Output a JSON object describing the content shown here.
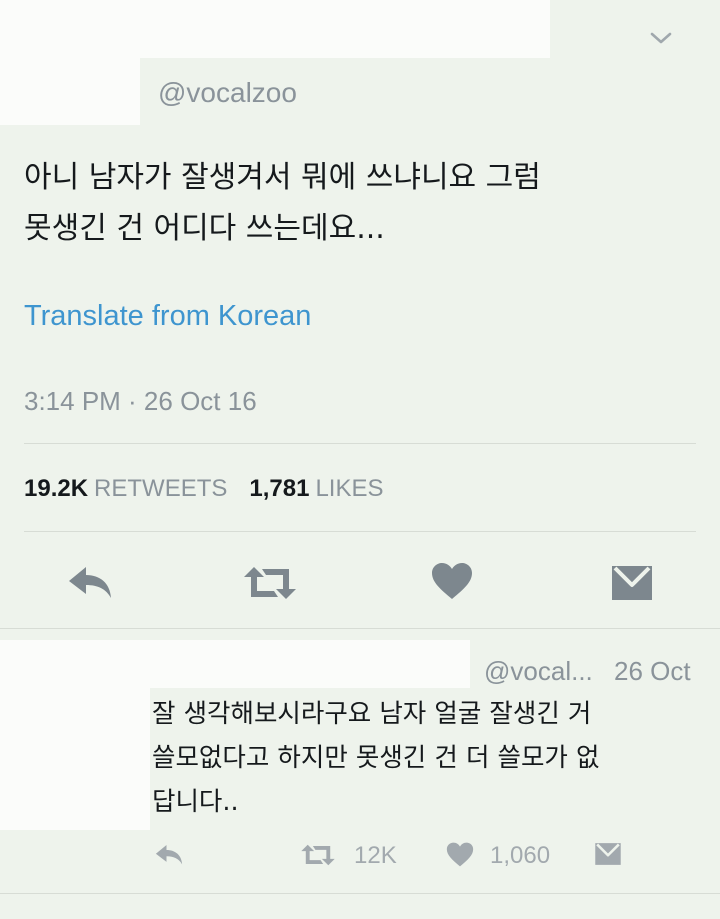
{
  "tweet": {
    "handle": "@vocalzoo",
    "text_line1": "아니 남자가 잘생겨서 뭐에 쓰냐니요 그럼",
    "text_line2": "못생긴 건 어디다 쓰는데요...",
    "translate_label": "Translate from Korean",
    "timestamp": "3:14 PM · 26 Oct 16",
    "retweets_count": "19.2K",
    "retweets_label": "RETWEETS",
    "likes_count": "1,781",
    "likes_label": "LIKES"
  },
  "reply": {
    "handle": "@vocal...",
    "time": "26 Oct",
    "text_line1": "잘 생각해보시라구요 남자 얼굴 잘생긴 거",
    "text_line2": "쓸모없다고 하지만 못생긴 건 더 쓸모가 없",
    "text_line3": "답니다..",
    "retweets_count": "12K",
    "likes_count": "1,060"
  },
  "colors": {
    "background": "#eef3ec",
    "link": "#3e95cf",
    "icon": "#7d878e",
    "muted_text": "#8a939a"
  },
  "icons": [
    "chevron-down-icon",
    "reply-icon",
    "retweet-icon",
    "heart-icon",
    "direct-message-icon"
  ]
}
